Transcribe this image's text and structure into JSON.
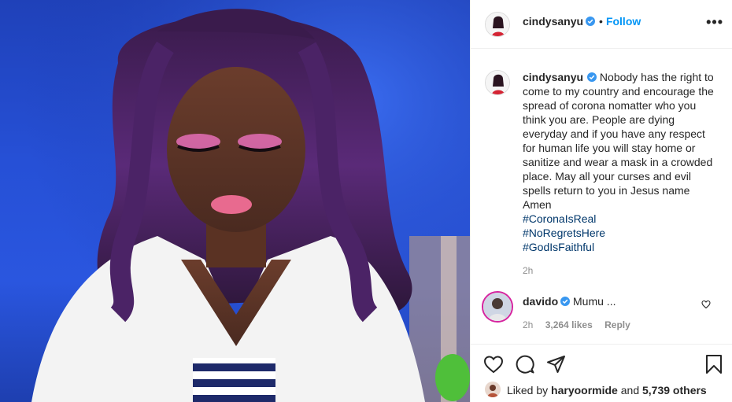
{
  "post": {
    "author": "cindysanyu",
    "follow_label": "Follow",
    "caption_text": "Nobody has the right to come to my country and encourage the spread of corona nomatter who you think you are. People are dying everyday and if you have any respect for human life you will stay home or sanitize and wear a mask in a crowded place. May all your curses and evil spells return to you in Jesus name Amen",
    "hashtags": [
      "#CoronaIsReal",
      "#NoRegretsHere",
      "#GodIsFaithful"
    ],
    "time_ago": "2h"
  },
  "comment": {
    "author": "davido",
    "text": "Mumu ...",
    "time_ago": "2h",
    "likes": "3,264 likes",
    "reply_label": "Reply"
  },
  "likes": {
    "prefix": "Liked by",
    "user": "haryoormide",
    "connector": "and",
    "others": "5,739 others"
  },
  "colors": {
    "accent": "#0095f6",
    "verified": "#3897f0",
    "hashtag": "#00376b",
    "muted": "#8e8e8e",
    "photo_bg": "#2650d6"
  },
  "icons": [
    "verified-badge-icon",
    "more-options-icon",
    "heart-icon",
    "comment-icon",
    "share-icon",
    "save-icon"
  ]
}
